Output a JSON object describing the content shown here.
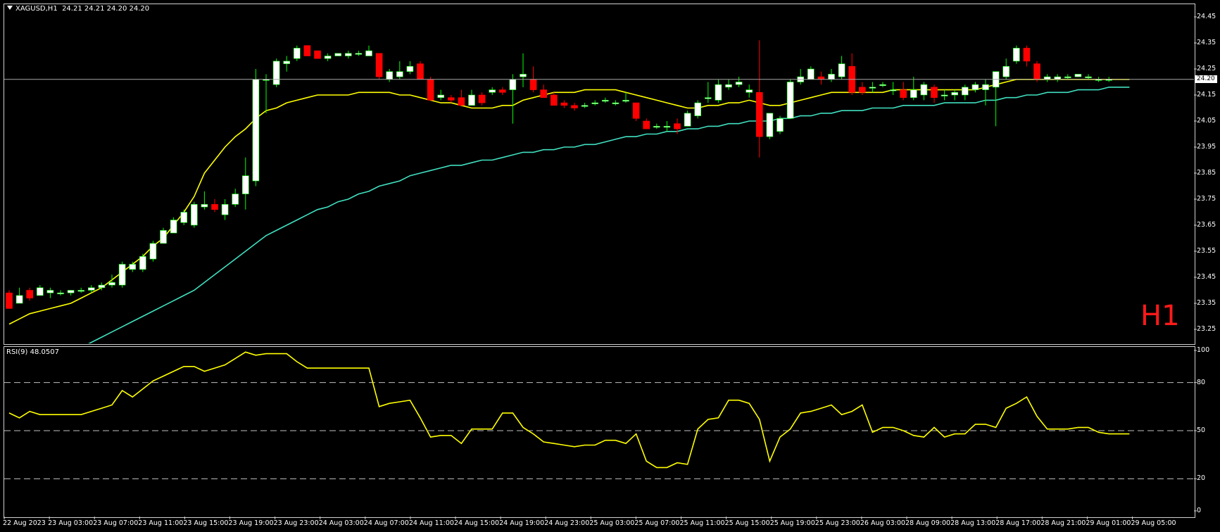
{
  "chart_header": {
    "symbol": "XAGUSD,H1",
    "ohlc": "24.21 24.21 24.20 24.20"
  },
  "timeframe_label": "H1",
  "current_price_tag": "24.20",
  "rsi_header": "RSI(9) 48.0507",
  "colors": {
    "background": "#000000",
    "bull_candle": "#ffffff",
    "bear_candle": "#ff0000",
    "wick_up": "#00ff00",
    "wick_down": "#ff0000",
    "ma_fast": "#ffff00",
    "ma_slow": "#40e0c0",
    "rsi_line": "#ffff00",
    "grid": "#c0c0c0",
    "timeframe_text": "#ff1a1a"
  },
  "price_axis": [
    "24.45",
    "24.35",
    "24.25",
    "24.15",
    "24.05",
    "23.95",
    "23.85",
    "23.75",
    "23.65",
    "23.55",
    "23.45",
    "23.35",
    "23.25"
  ],
  "rsi_axis": [
    "100",
    "80",
    "50",
    "20",
    "0"
  ],
  "time_axis": [
    "22 Aug 2023",
    "23 Aug 03:00",
    "23 Aug 07:00",
    "23 Aug 11:00",
    "23 Aug 15:00",
    "23 Aug 19:00",
    "23 Aug 23:00",
    "24 Aug 03:00",
    "24 Aug 07:00",
    "24 Aug 11:00",
    "24 Aug 15:00",
    "24 Aug 19:00",
    "24 Aug 23:00",
    "25 Aug 03:00",
    "25 Aug 07:00",
    "25 Aug 11:00",
    "25 Aug 15:00",
    "25 Aug 19:00",
    "25 Aug 23:00",
    "26 Aug 03:00",
    "28 Aug 09:00",
    "28 Aug 13:00",
    "28 Aug 17:00",
    "28 Aug 21:00",
    "29 Aug 01:00",
    "29 Aug 05:00"
  ],
  "chart_data": [
    {
      "type": "candlestick",
      "title": "XAGUSD,H1",
      "ylim": [
        23.22,
        24.48
      ],
      "candles": [
        {
          "o": 23.39,
          "h": 23.4,
          "l": 23.33,
          "c": 23.33
        },
        {
          "o": 23.35,
          "h": 23.41,
          "l": 23.35,
          "c": 23.38
        },
        {
          "o": 23.4,
          "h": 23.41,
          "l": 23.36,
          "c": 23.37
        },
        {
          "o": 23.38,
          "h": 23.42,
          "l": 23.38,
          "c": 23.41
        },
        {
          "o": 23.39,
          "h": 23.41,
          "l": 23.37,
          "c": 23.4
        },
        {
          "o": 23.39,
          "h": 23.4,
          "l": 23.38,
          "c": 23.39
        },
        {
          "o": 23.39,
          "h": 23.4,
          "l": 23.38,
          "c": 23.4
        },
        {
          "o": 23.4,
          "h": 23.41,
          "l": 23.39,
          "c": 23.4
        },
        {
          "o": 23.4,
          "h": 23.42,
          "l": 23.39,
          "c": 23.41
        },
        {
          "o": 23.41,
          "h": 23.43,
          "l": 23.4,
          "c": 23.42
        },
        {
          "o": 23.42,
          "h": 23.46,
          "l": 23.41,
          "c": 23.43
        },
        {
          "o": 23.42,
          "h": 23.51,
          "l": 23.41,
          "c": 23.5
        },
        {
          "o": 23.48,
          "h": 23.51,
          "l": 23.47,
          "c": 23.5
        },
        {
          "o": 23.48,
          "h": 23.54,
          "l": 23.47,
          "c": 23.53
        },
        {
          "o": 23.52,
          "h": 23.59,
          "l": 23.51,
          "c": 23.58
        },
        {
          "o": 23.58,
          "h": 23.64,
          "l": 23.58,
          "c": 23.63
        },
        {
          "o": 23.62,
          "h": 23.68,
          "l": 23.62,
          "c": 23.67
        },
        {
          "o": 23.66,
          "h": 23.71,
          "l": 23.65,
          "c": 23.7
        },
        {
          "o": 23.65,
          "h": 23.74,
          "l": 23.64,
          "c": 23.73
        },
        {
          "o": 23.72,
          "h": 23.78,
          "l": 23.71,
          "c": 23.73
        },
        {
          "o": 23.73,
          "h": 23.75,
          "l": 23.7,
          "c": 23.71
        },
        {
          "o": 23.69,
          "h": 23.75,
          "l": 23.67,
          "c": 23.73
        },
        {
          "o": 23.73,
          "h": 23.79,
          "l": 23.72,
          "c": 23.77
        },
        {
          "o": 23.77,
          "h": 23.91,
          "l": 23.71,
          "c": 23.84
        },
        {
          "o": 23.82,
          "h": 24.25,
          "l": 23.8,
          "c": 24.21
        },
        {
          "o": 24.21,
          "h": 24.23,
          "l": 24.08,
          "c": 24.21
        },
        {
          "o": 24.19,
          "h": 24.29,
          "l": 24.18,
          "c": 24.28
        },
        {
          "o": 24.27,
          "h": 24.3,
          "l": 24.24,
          "c": 24.28
        },
        {
          "o": 24.29,
          "h": 24.34,
          "l": 24.28,
          "c": 24.33
        },
        {
          "o": 24.34,
          "h": 24.34,
          "l": 24.3,
          "c": 24.3
        },
        {
          "o": 24.32,
          "h": 24.32,
          "l": 24.29,
          "c": 24.29
        },
        {
          "o": 24.29,
          "h": 24.31,
          "l": 24.28,
          "c": 24.3
        },
        {
          "o": 24.3,
          "h": 24.31,
          "l": 24.3,
          "c": 24.31
        },
        {
          "o": 24.3,
          "h": 24.32,
          "l": 24.29,
          "c": 24.31
        },
        {
          "o": 24.31,
          "h": 24.32,
          "l": 24.3,
          "c": 24.31
        },
        {
          "o": 24.3,
          "h": 24.34,
          "l": 24.3,
          "c": 24.32
        },
        {
          "o": 24.31,
          "h": 24.31,
          "l": 24.21,
          "c": 24.22
        },
        {
          "o": 24.21,
          "h": 24.25,
          "l": 24.2,
          "c": 24.24
        },
        {
          "o": 24.22,
          "h": 24.28,
          "l": 24.21,
          "c": 24.24
        },
        {
          "o": 24.24,
          "h": 24.28,
          "l": 24.23,
          "c": 24.26
        },
        {
          "o": 24.27,
          "h": 24.28,
          "l": 24.21,
          "c": 24.21
        },
        {
          "o": 24.21,
          "h": 24.22,
          "l": 24.13,
          "c": 24.13
        },
        {
          "o": 24.14,
          "h": 24.17,
          "l": 24.13,
          "c": 24.15
        },
        {
          "o": 24.14,
          "h": 24.15,
          "l": 24.12,
          "c": 24.13
        },
        {
          "o": 24.14,
          "h": 24.17,
          "l": 24.11,
          "c": 24.11
        },
        {
          "o": 24.11,
          "h": 24.17,
          "l": 24.11,
          "c": 24.15
        },
        {
          "o": 24.15,
          "h": 24.16,
          "l": 24.11,
          "c": 24.12
        },
        {
          "o": 24.16,
          "h": 24.18,
          "l": 24.15,
          "c": 24.17
        },
        {
          "o": 24.17,
          "h": 24.18,
          "l": 24.15,
          "c": 24.16
        },
        {
          "o": 24.17,
          "h": 24.23,
          "l": 24.04,
          "c": 24.21
        },
        {
          "o": 24.22,
          "h": 24.31,
          "l": 24.18,
          "c": 24.23
        },
        {
          "o": 24.21,
          "h": 24.26,
          "l": 24.16,
          "c": 24.17
        },
        {
          "o": 24.17,
          "h": 24.19,
          "l": 24.14,
          "c": 24.14
        },
        {
          "o": 24.15,
          "h": 24.16,
          "l": 24.11,
          "c": 24.11
        },
        {
          "o": 24.12,
          "h": 24.13,
          "l": 24.1,
          "c": 24.11
        },
        {
          "o": 24.11,
          "h": 24.12,
          "l": 24.09,
          "c": 24.1
        },
        {
          "o": 24.11,
          "h": 24.12,
          "l": 24.1,
          "c": 24.11
        },
        {
          "o": 24.12,
          "h": 24.13,
          "l": 24.11,
          "c": 24.12
        },
        {
          "o": 24.13,
          "h": 24.14,
          "l": 24.12,
          "c": 24.13
        },
        {
          "o": 24.12,
          "h": 24.13,
          "l": 24.11,
          "c": 24.12
        },
        {
          "o": 24.13,
          "h": 24.16,
          "l": 24.12,
          "c": 24.13
        },
        {
          "o": 24.12,
          "h": 24.12,
          "l": 24.05,
          "c": 24.06
        },
        {
          "o": 24.05,
          "h": 24.06,
          "l": 24.02,
          "c": 24.02
        },
        {
          "o": 24.03,
          "h": 24.04,
          "l": 24.02,
          "c": 24.03
        },
        {
          "o": 24.03,
          "h": 24.05,
          "l": 24.01,
          "c": 24.03
        },
        {
          "o": 24.04,
          "h": 24.06,
          "l": 24.0,
          "c": 24.02
        },
        {
          "o": 24.03,
          "h": 24.09,
          "l": 24.03,
          "c": 24.08
        },
        {
          "o": 24.07,
          "h": 24.13,
          "l": 24.06,
          "c": 24.12
        },
        {
          "o": 24.14,
          "h": 24.2,
          "l": 24.12,
          "c": 24.14
        },
        {
          "o": 24.13,
          "h": 24.21,
          "l": 24.12,
          "c": 24.19
        },
        {
          "o": 24.18,
          "h": 24.21,
          "l": 24.17,
          "c": 24.19
        },
        {
          "o": 24.19,
          "h": 24.22,
          "l": 24.18,
          "c": 24.2
        },
        {
          "o": 24.16,
          "h": 24.19,
          "l": 24.14,
          "c": 24.17
        },
        {
          "o": 24.16,
          "h": 24.36,
          "l": 23.91,
          "c": 23.99
        },
        {
          "o": 23.99,
          "h": 24.08,
          "l": 23.98,
          "c": 24.08
        },
        {
          "o": 24.01,
          "h": 24.07,
          "l": 24.0,
          "c": 24.06
        },
        {
          "o": 24.06,
          "h": 24.21,
          "l": 24.06,
          "c": 24.2
        },
        {
          "o": 24.2,
          "h": 24.25,
          "l": 24.19,
          "c": 24.22
        },
        {
          "o": 24.21,
          "h": 24.26,
          "l": 24.21,
          "c": 24.25
        },
        {
          "o": 24.22,
          "h": 24.24,
          "l": 24.19,
          "c": 24.21
        },
        {
          "o": 24.21,
          "h": 24.25,
          "l": 24.2,
          "c": 24.23
        },
        {
          "o": 24.22,
          "h": 24.3,
          "l": 24.21,
          "c": 24.27
        },
        {
          "o": 24.26,
          "h": 24.31,
          "l": 24.15,
          "c": 24.16
        },
        {
          "o": 24.18,
          "h": 24.2,
          "l": 24.15,
          "c": 24.16
        },
        {
          "o": 24.18,
          "h": 24.2,
          "l": 24.16,
          "c": 24.18
        },
        {
          "o": 24.19,
          "h": 24.2,
          "l": 24.18,
          "c": 24.19
        },
        {
          "o": 24.17,
          "h": 24.2,
          "l": 24.15,
          "c": 24.17
        },
        {
          "o": 24.17,
          "h": 24.2,
          "l": 24.13,
          "c": 24.14
        },
        {
          "o": 24.14,
          "h": 24.22,
          "l": 24.13,
          "c": 24.17
        },
        {
          "o": 24.15,
          "h": 24.2,
          "l": 24.13,
          "c": 24.19
        },
        {
          "o": 24.18,
          "h": 24.19,
          "l": 24.12,
          "c": 24.14
        },
        {
          "o": 24.15,
          "h": 24.17,
          "l": 24.13,
          "c": 24.15
        },
        {
          "o": 24.15,
          "h": 24.17,
          "l": 24.13,
          "c": 24.16
        },
        {
          "o": 24.15,
          "h": 24.19,
          "l": 24.13,
          "c": 24.18
        },
        {
          "o": 24.17,
          "h": 24.2,
          "l": 24.16,
          "c": 24.19
        },
        {
          "o": 24.17,
          "h": 24.21,
          "l": 24.11,
          "c": 24.19
        },
        {
          "o": 24.18,
          "h": 24.24,
          "l": 24.03,
          "c": 24.24
        },
        {
          "o": 24.22,
          "h": 24.29,
          "l": 24.21,
          "c": 24.26
        },
        {
          "o": 24.28,
          "h": 24.34,
          "l": 24.27,
          "c": 24.33
        },
        {
          "o": 24.33,
          "h": 24.34,
          "l": 24.26,
          "c": 24.28
        },
        {
          "o": 24.27,
          "h": 24.28,
          "l": 24.2,
          "c": 24.21
        },
        {
          "o": 24.21,
          "h": 24.23,
          "l": 24.2,
          "c": 24.22
        },
        {
          "o": 24.21,
          "h": 24.23,
          "l": 24.2,
          "c": 24.22
        },
        {
          "o": 24.22,
          "h": 24.23,
          "l": 24.21,
          "c": 24.22
        },
        {
          "o": 24.22,
          "h": 24.23,
          "l": 24.22,
          "c": 24.23
        },
        {
          "o": 24.22,
          "h": 24.23,
          "l": 24.21,
          "c": 24.22
        },
        {
          "o": 24.21,
          "h": 24.22,
          "l": 24.2,
          "c": 24.21
        },
        {
          "o": 24.21,
          "h": 24.22,
          "l": 24.2,
          "c": 24.21
        }
      ],
      "ma_fast": [
        23.27,
        23.29,
        23.31,
        23.32,
        23.33,
        23.34,
        23.35,
        23.37,
        23.39,
        23.41,
        23.44,
        23.47,
        23.5,
        23.53,
        23.57,
        23.6,
        23.65,
        23.7,
        23.76,
        23.85,
        23.9,
        23.95,
        23.99,
        24.02,
        24.06,
        24.09,
        24.1,
        24.12,
        24.13,
        24.14,
        24.15,
        24.15,
        24.15,
        24.15,
        24.16,
        24.16,
        24.16,
        24.16,
        24.15,
        24.15,
        24.14,
        24.13,
        24.12,
        24.12,
        24.11,
        24.1,
        24.1,
        24.1,
        24.11,
        24.11,
        24.13,
        24.14,
        24.15,
        24.16,
        24.16,
        24.16,
        24.17,
        24.17,
        24.17,
        24.17,
        24.16,
        24.15,
        24.14,
        24.13,
        24.12,
        24.11,
        24.1,
        24.1,
        24.11,
        24.11,
        24.12,
        24.12,
        24.13,
        24.12,
        24.11,
        24.11,
        24.12,
        24.13,
        24.14,
        24.15,
        24.16,
        24.16,
        24.16,
        24.16,
        24.16,
        24.16,
        24.17,
        24.17,
        24.17,
        24.17,
        24.17,
        24.17,
        24.17,
        24.17,
        24.17,
        24.18,
        24.19,
        24.2,
        24.21,
        24.21,
        24.21,
        24.21,
        24.21,
        24.21,
        24.21,
        24.21,
        24.21,
        24.21,
        24.21,
        24.21
      ],
      "ma_slow": [
        23.04,
        23.06,
        23.08,
        23.1,
        23.12,
        23.14,
        23.16,
        23.18,
        23.2,
        23.22,
        23.24,
        23.26,
        23.28,
        23.3,
        23.32,
        23.34,
        23.36,
        23.38,
        23.4,
        23.43,
        23.46,
        23.49,
        23.52,
        23.55,
        23.58,
        23.61,
        23.63,
        23.65,
        23.67,
        23.69,
        23.71,
        23.72,
        23.74,
        23.75,
        23.77,
        23.78,
        23.8,
        23.81,
        23.82,
        23.84,
        23.85,
        23.86,
        23.87,
        23.88,
        23.88,
        23.89,
        23.9,
        23.9,
        23.91,
        23.92,
        23.93,
        23.93,
        23.94,
        23.94,
        23.95,
        23.95,
        23.96,
        23.96,
        23.97,
        23.98,
        23.99,
        23.99,
        24.0,
        24.0,
        24.01,
        24.01,
        24.02,
        24.02,
        24.03,
        24.03,
        24.04,
        24.04,
        24.05,
        24.05,
        24.05,
        24.06,
        24.06,
        24.07,
        24.07,
        24.08,
        24.08,
        24.09,
        24.09,
        24.09,
        24.1,
        24.1,
        24.1,
        24.11,
        24.11,
        24.11,
        24.11,
        24.12,
        24.12,
        24.12,
        24.12,
        24.13,
        24.13,
        24.14,
        24.14,
        24.15,
        24.15,
        24.16,
        24.16,
        24.16,
        24.17,
        24.17,
        24.17,
        24.18,
        24.18,
        24.18
      ]
    },
    {
      "type": "line",
      "title": "RSI(9) 48.0507",
      "ylim": [
        0,
        100
      ],
      "levels": [
        80,
        50,
        20
      ],
      "values": [
        61,
        58,
        62,
        60,
        60,
        60,
        60,
        60,
        62,
        64,
        66,
        75,
        71,
        76,
        81,
        84,
        87,
        90,
        90,
        87,
        89,
        91,
        95,
        99,
        97,
        98,
        98,
        98,
        93,
        89,
        89,
        89,
        89,
        89,
        89,
        89,
        65,
        67,
        68,
        69,
        58,
        46,
        47,
        47,
        42,
        51,
        51,
        51,
        61,
        61,
        52,
        48,
        43,
        42,
        41,
        40,
        41,
        41,
        44,
        44,
        42,
        48,
        31,
        27,
        27,
        30,
        29,
        51,
        57,
        58,
        69,
        69,
        67,
        57,
        31,
        46,
        51,
        61,
        62,
        64,
        66,
        60,
        62,
        66,
        49,
        52,
        52,
        50,
        47,
        46,
        52,
        46,
        48,
        48,
        54,
        54,
        52,
        64,
        67,
        71,
        59,
        51,
        51,
        51,
        52,
        52,
        49,
        48,
        48,
        48
      ]
    }
  ]
}
